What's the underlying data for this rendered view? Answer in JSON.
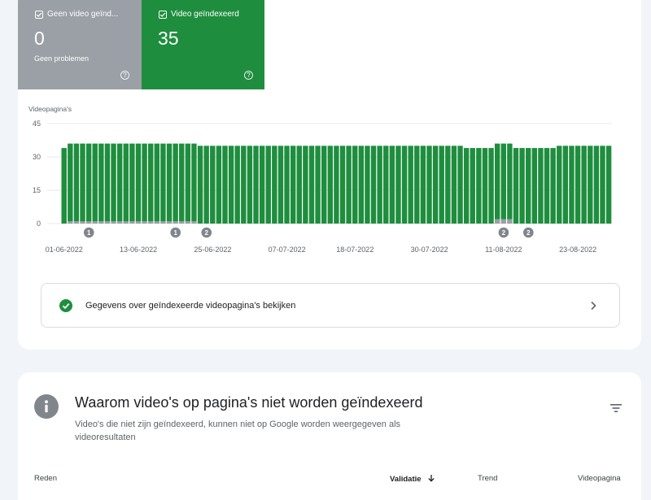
{
  "tiles": {
    "not_indexed": {
      "label": "Geen video geïnd...",
      "count": "0",
      "sub": "Geen problemen",
      "help_icon": "?"
    },
    "indexed": {
      "label": "Video geïndexeerd",
      "count": "35",
      "help_icon": "?"
    }
  },
  "colors": {
    "indexed": "#1e8e3e",
    "not_indexed": "#9aa0a6",
    "annotation": "#80868b",
    "grid": "#e8eaed"
  },
  "chart_data": {
    "type": "bar",
    "stacked": true,
    "ylabel": "Videopagina's",
    "ylim": [
      0,
      45
    ],
    "yticks": [
      "45",
      "30",
      "15",
      "0"
    ],
    "xtick_labels": [
      "01-06-2022",
      "13-06-2022",
      "25-06-2022",
      "07-07-2022",
      "18-07-2022",
      "30-07-2022",
      "11-08-2022",
      "23-08-2022"
    ],
    "x_start": "01-06-2022",
    "x_end": "28-08-2022",
    "series": [
      {
        "name": "Video geïndexeerd",
        "color": "#1e8e3e",
        "values": [
          34,
          35,
          35,
          35,
          35,
          35,
          35,
          35,
          35,
          35,
          35,
          35,
          35,
          35,
          35,
          35,
          35,
          35,
          35,
          35,
          35,
          35,
          35,
          35,
          35,
          35,
          35,
          35,
          35,
          35,
          35,
          35,
          35,
          35,
          35,
          35,
          35,
          35,
          35,
          35,
          35,
          35,
          35,
          35,
          35,
          35,
          35,
          35,
          35,
          35,
          35,
          35,
          35,
          35,
          35,
          35,
          35,
          35,
          35,
          35,
          35,
          35,
          35,
          35,
          35,
          34,
          34,
          34,
          34,
          34,
          34,
          34,
          34,
          34,
          34,
          34,
          34,
          34,
          34,
          34,
          35,
          35,
          35,
          35,
          35,
          35,
          35,
          35,
          35
        ]
      },
      {
        "name": "Geen video geïndexeerd",
        "color": "#9aa0a6",
        "values": [
          0,
          1,
          1,
          1,
          1,
          1,
          1,
          1,
          1,
          1,
          1,
          1,
          1,
          1,
          1,
          1,
          1,
          1,
          1,
          1,
          1,
          1,
          0,
          0,
          0,
          0,
          0,
          0,
          0,
          0,
          0,
          0,
          0,
          0,
          0,
          0,
          0,
          0,
          0,
          0,
          0,
          0,
          0,
          0,
          0,
          0,
          0,
          0,
          0,
          0,
          0,
          0,
          0,
          0,
          0,
          0,
          0,
          0,
          0,
          0,
          0,
          0,
          0,
          0,
          0,
          0,
          0,
          0,
          0,
          0,
          2,
          2,
          2,
          0,
          0,
          0,
          0,
          0,
          0,
          0,
          0,
          0,
          0,
          0,
          0,
          0,
          0,
          0,
          0
        ]
      }
    ],
    "annotations": [
      {
        "date": "05-06-2022",
        "label": "1"
      },
      {
        "date": "19-06-2022",
        "label": "1"
      },
      {
        "date": "24-06-2022",
        "label": "2"
      },
      {
        "date": "11-08-2022",
        "label": "2"
      },
      {
        "date": "15-08-2022",
        "label": "2"
      }
    ]
  },
  "details_link": {
    "label": "Gegevens over geïndexeerde videopagina's bekijken"
  },
  "issues": {
    "title": "Waarom video's op pagina's niet worden geïndexeerd",
    "description": "Video's die niet zijn geïndexeerd, kunnen niet op Google worden weergegeven als videoresultaten",
    "columns": {
      "reason": "Reden",
      "validation": "Validatie",
      "trend": "Trend",
      "pages": "Videopagina"
    }
  }
}
